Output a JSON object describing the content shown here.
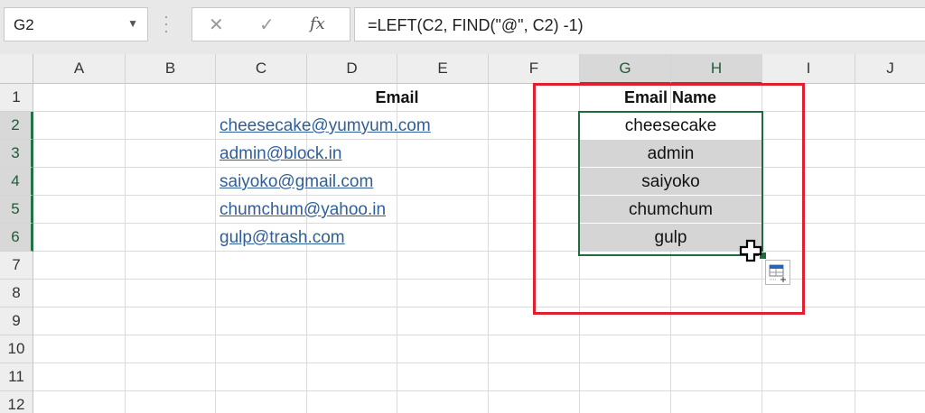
{
  "formula_bar": {
    "name_box": "G2",
    "name_box_dropdown_icon": "chevron-down-icon",
    "cancel_icon": "✕",
    "enter_icon": "✓",
    "fx_label": "fx",
    "formula": "=LEFT(C2, FIND(\"@\", C2) -1)"
  },
  "columns": [
    "A",
    "B",
    "C",
    "D",
    "E",
    "F",
    "G",
    "H",
    "I",
    "J"
  ],
  "rows": [
    "1",
    "2",
    "3",
    "4",
    "5",
    "6",
    "7",
    "8",
    "9",
    "10",
    "11",
    "12"
  ],
  "headers": {
    "email": "Email",
    "email_name": "Email Name"
  },
  "emails": [
    "cheesecake@yumyum.com",
    "admin@block.in",
    "saiyoko@gmail.com",
    "chumchum@yahoo.in",
    "gulp@trash.com"
  ],
  "email_names": [
    "cheesecake",
    "admin",
    "saiyoko",
    "chumchum",
    "gulp"
  ],
  "selection": {
    "range": "G2:H6",
    "active_cell": "G2"
  },
  "colors": {
    "selection": "#1f6b3e",
    "highlight_box": "#e0202f",
    "link": "#2f5f9a",
    "selected_fill": "#d5d5d5"
  },
  "icons": {
    "cursor": "plus-cursor-icon",
    "quick_analysis": "quick-analysis-icon"
  }
}
